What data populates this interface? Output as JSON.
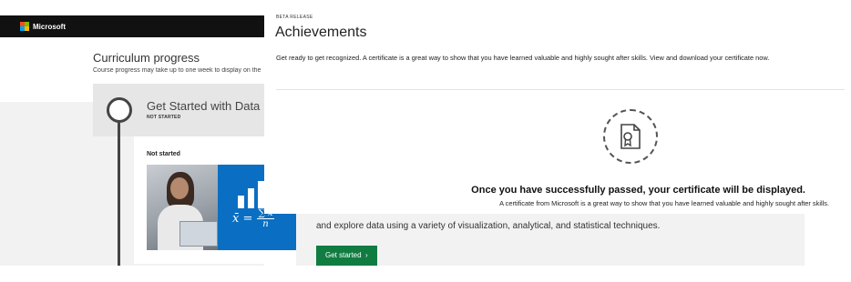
{
  "header": {
    "brand": "Microsoft"
  },
  "curriculum": {
    "title": "Curriculum progress",
    "subtitle": "Course progress may take up to one week to display on the",
    "course": {
      "title": "Get Started with Data",
      "status": "NOT STARTED",
      "card_status": "Not started",
      "formula": {
        "lhs": "x̄ =",
        "numerator": "∑ x",
        "denominator": "n"
      },
      "description": "and explore data using a variety of visualization, analytical, and statistical techniques.",
      "cta_label": "Get started"
    }
  },
  "achievements": {
    "badge": "BETA RELEASE",
    "title": "Achievements",
    "description": "Get ready to get recognized. A certificate is a great way to show that you have learned valuable and highly sought after skills. View and download your certificate now.",
    "certificate_message": "Once you have successfully passed, your certificate will be displayed.",
    "certificate_sub": "A certificate from Microsoft is a great way to show that you have learned valuable and highly sought after skills."
  },
  "colors": {
    "topbar": "#111111",
    "cta": "#107c41",
    "hero_panel": "#0a6fc2",
    "grey_band": "#f2f2f2"
  },
  "icons": [
    "microsoft-logo-icon",
    "certificate-icon",
    "chevron-right-icon"
  ]
}
